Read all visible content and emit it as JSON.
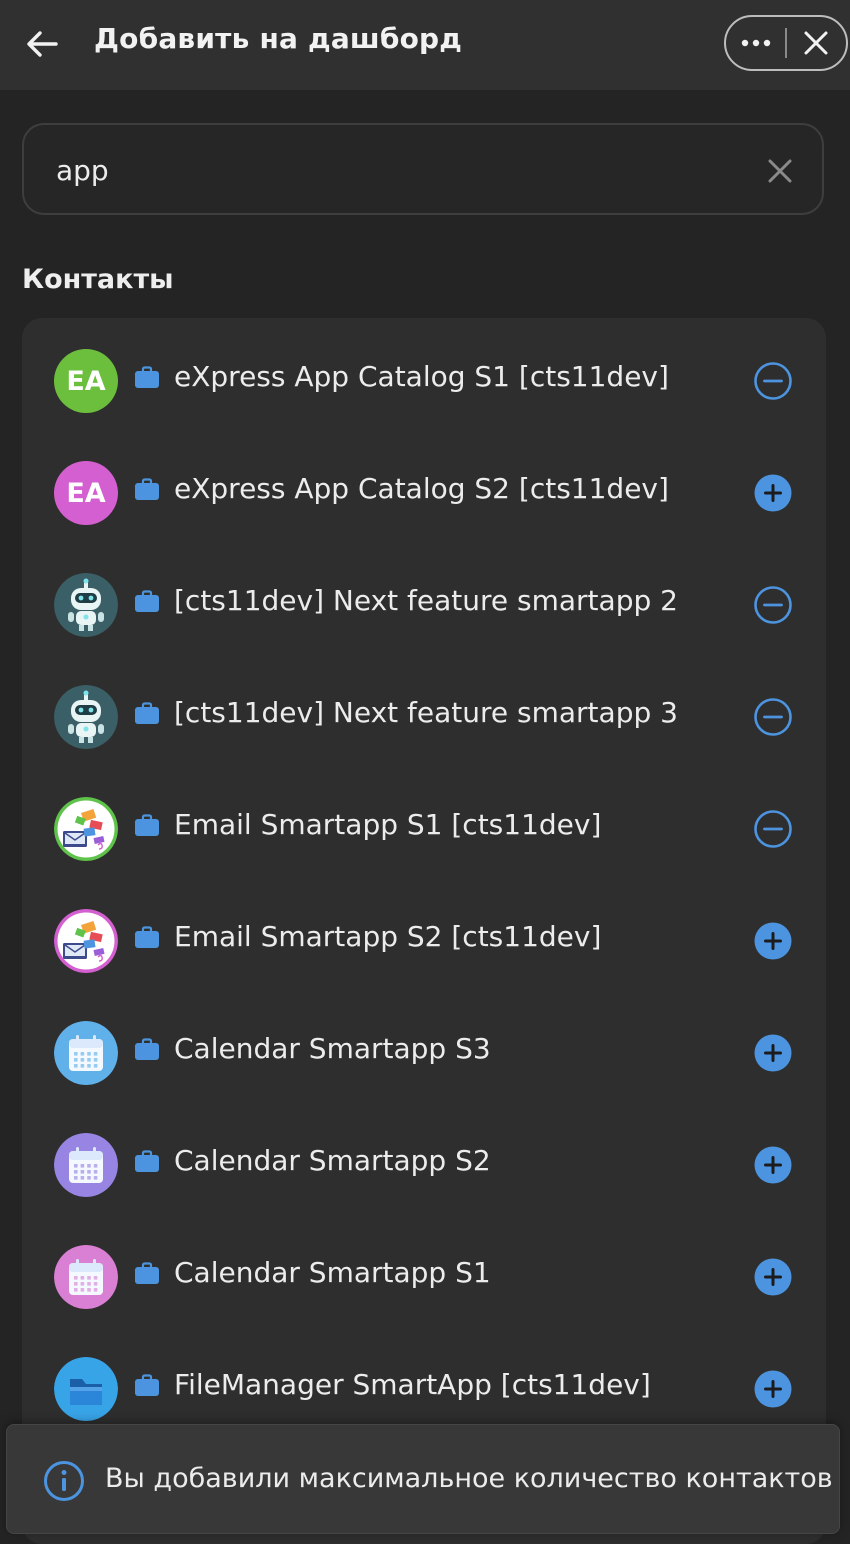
{
  "header": {
    "title": "Добавить на дашборд",
    "back_icon": "arrow-left-icon",
    "more_icon": "more-horizontal-icon",
    "close_icon": "close-icon"
  },
  "search": {
    "value": "app",
    "clear_icon": "clear-icon"
  },
  "section": {
    "title": "Контакты"
  },
  "contacts": [
    {
      "label": "eXpress App Catalog S1 [cts11dev]",
      "avatar": "initials",
      "initials": "EA",
      "avatar_color": "#6cbf3c",
      "action": "remove"
    },
    {
      "label": "eXpress App Catalog S2 [cts11dev]",
      "avatar": "initials",
      "initials": "EA",
      "avatar_color": "#d45fd0",
      "action": "add"
    },
    {
      "label": "[cts11dev] Next feature smartapp 2",
      "avatar": "robot",
      "action": "remove"
    },
    {
      "label": "[cts11dev] Next feature smartapp 3",
      "avatar": "robot",
      "action": "remove"
    },
    {
      "label": "Email Smartapp S1 [cts11dev]",
      "avatar": "email",
      "ring_color": "#5fc24a",
      "action": "remove"
    },
    {
      "label": "Email Smartapp S2 [cts11dev]",
      "avatar": "email",
      "ring_color": "#d45fd0",
      "action": "add"
    },
    {
      "label": "Calendar Smartapp S3",
      "avatar": "calendar",
      "avatar_color": "#4aa7e8",
      "action": "add"
    },
    {
      "label": "Calendar Smartapp S2",
      "avatar": "calendar",
      "avatar_color": "#8a73e0",
      "action": "add"
    },
    {
      "label": "Calendar Smartapp S1",
      "avatar": "calendar",
      "avatar_color": "#d56fcf",
      "action": "add"
    },
    {
      "label": "FileManager SmartApp [cts11dev]",
      "avatar": "folder",
      "avatar_color": "#38a4e8",
      "action": "add"
    }
  ],
  "toast": {
    "text": "Вы добавили максимальное количество контактов",
    "icon": "info-icon"
  },
  "colors": {
    "accent": "#4d94e0",
    "background": "#242424",
    "header": "#303030",
    "list": "#2e2e2e"
  }
}
